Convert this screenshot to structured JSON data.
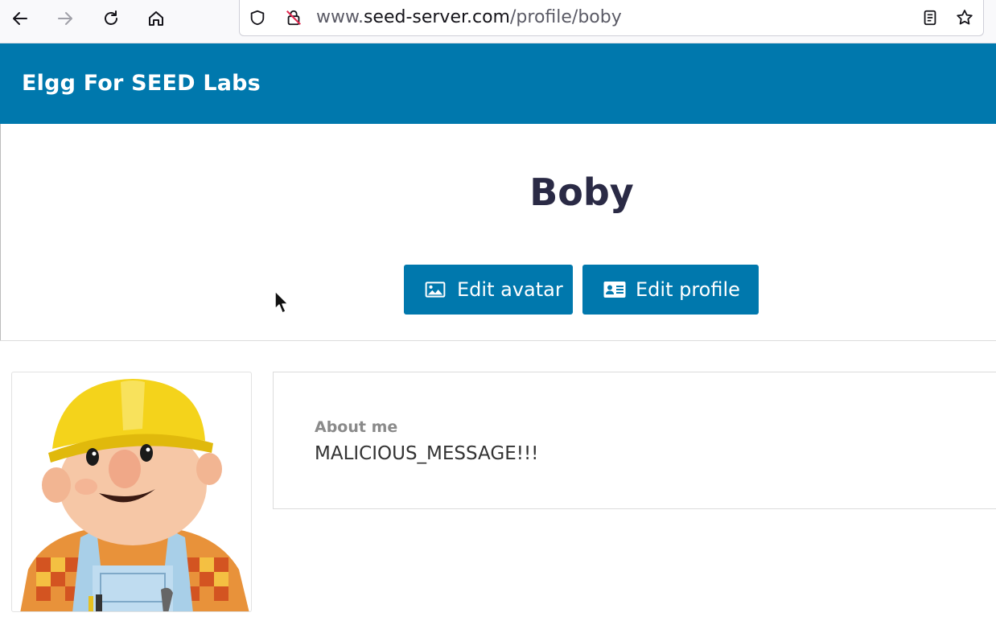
{
  "browser": {
    "url_prefix": "www.",
    "url_host": "seed-server.com",
    "url_path": "/profile/boby"
  },
  "site": {
    "title": "Elgg For SEED Labs",
    "accent_color": "#0078ad"
  },
  "profile": {
    "name": "Boby",
    "edit_avatar_label": "Edit avatar",
    "edit_profile_label": "Edit profile",
    "about_label": "About me",
    "about_value": "MALICIOUS_MESSAGE!!!"
  }
}
